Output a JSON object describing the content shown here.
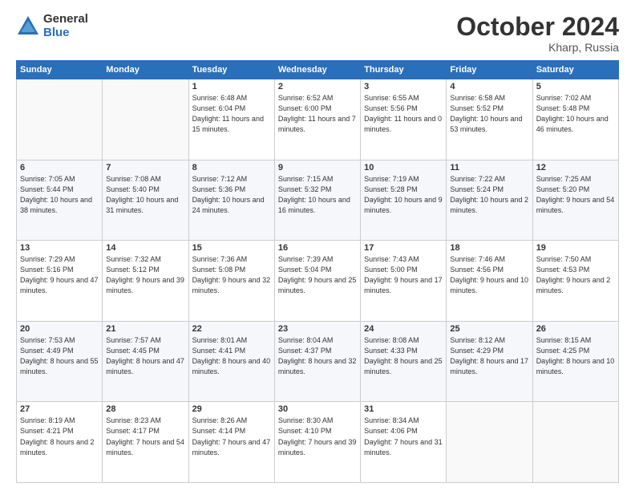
{
  "logo": {
    "general": "General",
    "blue": "Blue"
  },
  "header": {
    "month": "October 2024",
    "location": "Kharp, Russia"
  },
  "weekdays": [
    "Sunday",
    "Monday",
    "Tuesday",
    "Wednesday",
    "Thursday",
    "Friday",
    "Saturday"
  ],
  "weeks": [
    [
      {
        "day": "",
        "content": ""
      },
      {
        "day": "",
        "content": ""
      },
      {
        "day": "1",
        "content": "Sunrise: 6:48 AM\nSunset: 6:04 PM\nDaylight: 11 hours\nand 15 minutes."
      },
      {
        "day": "2",
        "content": "Sunrise: 6:52 AM\nSunset: 6:00 PM\nDaylight: 11 hours\nand 7 minutes."
      },
      {
        "day": "3",
        "content": "Sunrise: 6:55 AM\nSunset: 5:56 PM\nDaylight: 11 hours\nand 0 minutes."
      },
      {
        "day": "4",
        "content": "Sunrise: 6:58 AM\nSunset: 5:52 PM\nDaylight: 10 hours\nand 53 minutes."
      },
      {
        "day": "5",
        "content": "Sunrise: 7:02 AM\nSunset: 5:48 PM\nDaylight: 10 hours\nand 46 minutes."
      }
    ],
    [
      {
        "day": "6",
        "content": "Sunrise: 7:05 AM\nSunset: 5:44 PM\nDaylight: 10 hours\nand 38 minutes."
      },
      {
        "day": "7",
        "content": "Sunrise: 7:08 AM\nSunset: 5:40 PM\nDaylight: 10 hours\nand 31 minutes."
      },
      {
        "day": "8",
        "content": "Sunrise: 7:12 AM\nSunset: 5:36 PM\nDaylight: 10 hours\nand 24 minutes."
      },
      {
        "day": "9",
        "content": "Sunrise: 7:15 AM\nSunset: 5:32 PM\nDaylight: 10 hours\nand 16 minutes."
      },
      {
        "day": "10",
        "content": "Sunrise: 7:19 AM\nSunset: 5:28 PM\nDaylight: 10 hours\nand 9 minutes."
      },
      {
        "day": "11",
        "content": "Sunrise: 7:22 AM\nSunset: 5:24 PM\nDaylight: 10 hours\nand 2 minutes."
      },
      {
        "day": "12",
        "content": "Sunrise: 7:25 AM\nSunset: 5:20 PM\nDaylight: 9 hours\nand 54 minutes."
      }
    ],
    [
      {
        "day": "13",
        "content": "Sunrise: 7:29 AM\nSunset: 5:16 PM\nDaylight: 9 hours\nand 47 minutes."
      },
      {
        "day": "14",
        "content": "Sunrise: 7:32 AM\nSunset: 5:12 PM\nDaylight: 9 hours\nand 39 minutes."
      },
      {
        "day": "15",
        "content": "Sunrise: 7:36 AM\nSunset: 5:08 PM\nDaylight: 9 hours\nand 32 minutes."
      },
      {
        "day": "16",
        "content": "Sunrise: 7:39 AM\nSunset: 5:04 PM\nDaylight: 9 hours\nand 25 minutes."
      },
      {
        "day": "17",
        "content": "Sunrise: 7:43 AM\nSunset: 5:00 PM\nDaylight: 9 hours\nand 17 minutes."
      },
      {
        "day": "18",
        "content": "Sunrise: 7:46 AM\nSunset: 4:56 PM\nDaylight: 9 hours\nand 10 minutes."
      },
      {
        "day": "19",
        "content": "Sunrise: 7:50 AM\nSunset: 4:53 PM\nDaylight: 9 hours\nand 2 minutes."
      }
    ],
    [
      {
        "day": "20",
        "content": "Sunrise: 7:53 AM\nSunset: 4:49 PM\nDaylight: 8 hours\nand 55 minutes."
      },
      {
        "day": "21",
        "content": "Sunrise: 7:57 AM\nSunset: 4:45 PM\nDaylight: 8 hours\nand 47 minutes."
      },
      {
        "day": "22",
        "content": "Sunrise: 8:01 AM\nSunset: 4:41 PM\nDaylight: 8 hours\nand 40 minutes."
      },
      {
        "day": "23",
        "content": "Sunrise: 8:04 AM\nSunset: 4:37 PM\nDaylight: 8 hours\nand 32 minutes."
      },
      {
        "day": "24",
        "content": "Sunrise: 8:08 AM\nSunset: 4:33 PM\nDaylight: 8 hours\nand 25 minutes."
      },
      {
        "day": "25",
        "content": "Sunrise: 8:12 AM\nSunset: 4:29 PM\nDaylight: 8 hours\nand 17 minutes."
      },
      {
        "day": "26",
        "content": "Sunrise: 8:15 AM\nSunset: 4:25 PM\nDaylight: 8 hours\nand 10 minutes."
      }
    ],
    [
      {
        "day": "27",
        "content": "Sunrise: 8:19 AM\nSunset: 4:21 PM\nDaylight: 8 hours\nand 2 minutes."
      },
      {
        "day": "28",
        "content": "Sunrise: 8:23 AM\nSunset: 4:17 PM\nDaylight: 7 hours\nand 54 minutes."
      },
      {
        "day": "29",
        "content": "Sunrise: 8:26 AM\nSunset: 4:14 PM\nDaylight: 7 hours\nand 47 minutes."
      },
      {
        "day": "30",
        "content": "Sunrise: 8:30 AM\nSunset: 4:10 PM\nDaylight: 7 hours\nand 39 minutes."
      },
      {
        "day": "31",
        "content": "Sunrise: 8:34 AM\nSunset: 4:06 PM\nDaylight: 7 hours\nand 31 minutes."
      },
      {
        "day": "",
        "content": ""
      },
      {
        "day": "",
        "content": ""
      }
    ]
  ]
}
